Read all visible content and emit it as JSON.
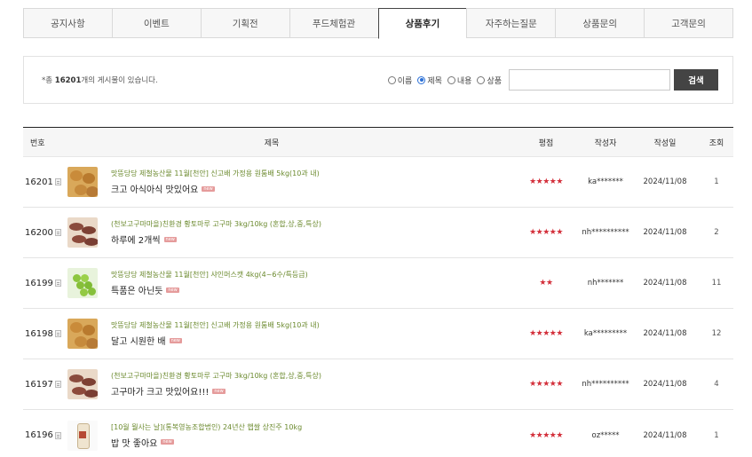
{
  "tabs": [
    {
      "label": "공지사항",
      "active": false
    },
    {
      "label": "이벤트",
      "active": false
    },
    {
      "label": "기획전",
      "active": false
    },
    {
      "label": "푸드체험관",
      "active": false
    },
    {
      "label": "상품후기",
      "active": true
    },
    {
      "label": "자주하는질문",
      "active": false
    },
    {
      "label": "상품문의",
      "active": false
    },
    {
      "label": "고객문의",
      "active": false
    }
  ],
  "search": {
    "count_prefix": "*총 ",
    "count": "16201",
    "count_suffix": "개의 게시물이 있습니다.",
    "options": [
      {
        "label": "이름",
        "checked": false
      },
      {
        "label": "제목",
        "checked": true
      },
      {
        "label": "내용",
        "checked": false
      },
      {
        "label": "상품",
        "checked": false
      }
    ],
    "input_value": "",
    "button_label": "검색"
  },
  "table": {
    "headers": {
      "no": "번호",
      "title": "제목",
      "rating": "평점",
      "writer": "작성자",
      "date": "작성일",
      "views": "조회"
    },
    "rows": [
      {
        "no": "16201",
        "thumb": "potato",
        "product": "맛뜽당당 제철농산물 11월[천안] 신고배 가정용 원툼배 5kg(10과 내)",
        "subject": "크고 아식아식 맛있어요",
        "stars": "★★★★★",
        "writer": "ka*******",
        "date": "2024/11/08",
        "views": "1",
        "icon": "document-icon"
      },
      {
        "no": "16200",
        "thumb": "sweet",
        "product": "(천보고구마마을)친환경 황토마루 고구마 3kg/10kg (혼합,상,중,특상)",
        "subject": "하루에 2개씩",
        "stars": "★★★★★",
        "writer": "nh**********",
        "date": "2024/11/08",
        "views": "2",
        "icon": "document-icon"
      },
      {
        "no": "16199",
        "thumb": "grape",
        "product": "맛뜽당당 제철농산물 11월[천안] 샤인머스캣 4kg(4~6수/특등급)",
        "subject": "특품은 아닌듯",
        "stars": "★★",
        "writer": "nh*******",
        "date": "2024/11/08",
        "views": "11",
        "icon": "edit-document-icon"
      },
      {
        "no": "16198",
        "thumb": "potato",
        "product": "맛뜽당당 제철농산물 11월[천안] 신고배 가정용 원툼배 5kg(10과 내)",
        "subject": "달고 시원한 배",
        "stars": "★★★★★",
        "writer": "ka*********",
        "date": "2024/11/08",
        "views": "12",
        "icon": "document-icon"
      },
      {
        "no": "16197",
        "thumb": "sweet",
        "product": "(천보고구마마을)친환경 황토마루 고구마 3kg/10kg (혼합,상,중,특상)",
        "subject": "고구마가 크고 맛있어요!!!",
        "stars": "★★★★★",
        "writer": "nh**********",
        "date": "2024/11/08",
        "views": "4",
        "icon": "document-icon"
      },
      {
        "no": "16196",
        "thumb": "rice",
        "product": "[10월 뭘사는 날](통복영농조합법인) 24년산 햅쌀 상진주 10kg",
        "subject": "밥 맛 좋아요",
        "stars": "★★★★★",
        "writer": "oz*****",
        "date": "2024/11/08",
        "views": "1",
        "icon": "document-icon"
      }
    ],
    "new_badge": "new"
  },
  "colors": {
    "accent": "#d32f3a",
    "product_text": "#6b8a2e",
    "button_bg": "#444444"
  }
}
